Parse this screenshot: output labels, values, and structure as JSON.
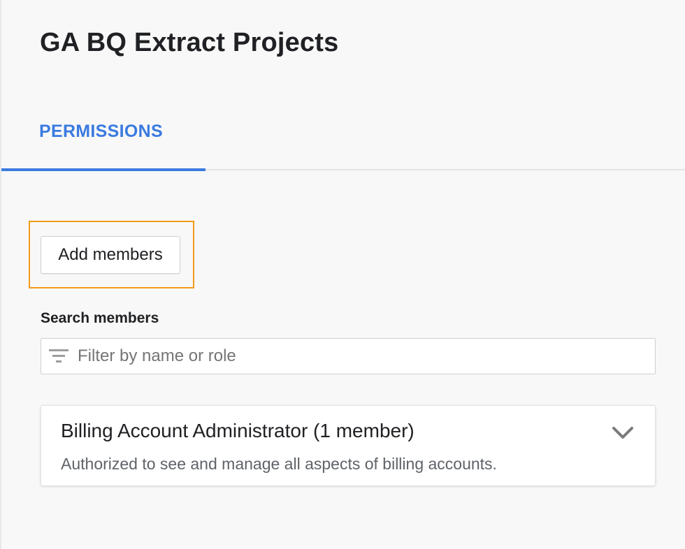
{
  "header": {
    "title": "GA BQ Extract Projects"
  },
  "tabs": [
    {
      "label": "PERMISSIONS",
      "active": true
    }
  ],
  "actions": {
    "add_members_label": "Add members"
  },
  "search": {
    "label": "Search members",
    "placeholder": "Filter by name or role",
    "value": ""
  },
  "roles": [
    {
      "title": "Billing Account Administrator (1 member)",
      "description": "Authorized to see and manage all aspects of billing accounts.",
      "expanded": false
    }
  ],
  "icons": {
    "filter": "filter-icon",
    "expand": "chevron-down-icon"
  },
  "colors": {
    "accent": "#3b7be0",
    "highlight": "#f29a1a"
  }
}
